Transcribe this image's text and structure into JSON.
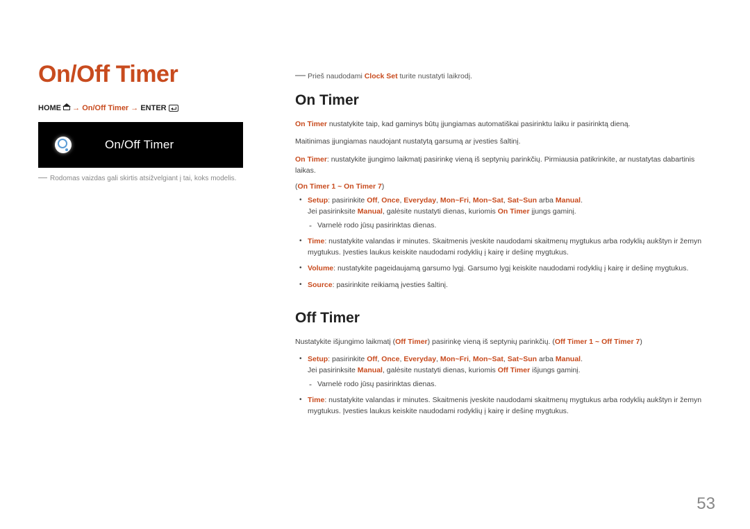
{
  "left": {
    "title": "On/Off Timer",
    "breadcrumb": {
      "home": "HOME",
      "arrow1": " → ",
      "mid": "On/Off Timer",
      "arrow2": " → ",
      "enter": "ENTER"
    },
    "screenshot_label": "On/Off Timer",
    "model_note": "Rodomas vaizdas gali skirtis atsižvelgiant į tai, koks modelis."
  },
  "right": {
    "top_note_prefix": "Prieš naudodami ",
    "top_note_strong": "Clock Set",
    "top_note_suffix": " turite nustatyti laikrodį.",
    "on_timer": {
      "heading": "On Timer",
      "p1_strong": "On Timer",
      "p1_rest": " nustatykite taip, kad gaminys būtų įjungiamas automatiškai pasirinktu laiku ir pasirinktą dieną.",
      "p2": "Maitinimas įjungiamas naudojant nustatytą garsumą ar įvesties šaltinį.",
      "p3_strong": "On Timer",
      "p3_rest": ": nustatykite įjungimo laikmatį pasirinkę vieną iš septynių parinkčių. Pirmiausia patikrinkite, ar nustatytas dabartinis laikas.",
      "range_open": "(",
      "range_text": "On Timer 1 ~ On Timer 7",
      "range_close": ")",
      "bullets": {
        "setup_label": "Setup",
        "setup_text_a": ": pasirinkite ",
        "setup_opt1": "Off",
        "setup_sep": ", ",
        "setup_opt2": "Once",
        "setup_opt3": "Everyday",
        "setup_opt4": "Mon~Fri",
        "setup_opt5": "Mon~Sat",
        "setup_opt6": "Sat~Sun",
        "setup_arba": " arba ",
        "setup_opt7": "Manual",
        "setup_period": ".",
        "setup_line2a": "Jei pasirinksite ",
        "setup_line2b": "Manual",
        "setup_line2c": ", galėsite nustatyti dienas, kuriomis ",
        "setup_line2d": "On Timer",
        "setup_line2e": " įjungs gaminį.",
        "setup_sub": "Varnelė rodo jūsų pasirinktas dienas.",
        "time_label": "Time",
        "time_text": ": nustatykite valandas ir minutes. Skaitmenis įveskite naudodami skaitmenų mygtukus arba rodyklių aukštyn ir žemyn mygtukus. Įvesties laukus keiskite naudodami rodyklių į kairę ir dešinę mygtukus.",
        "volume_label": "Volume",
        "volume_text": ": nustatykite pageidaujamą garsumo lygį. Garsumo lygį keiskite naudodami rodyklių į kairę ir dešinę mygtukus.",
        "source_label": "Source",
        "source_text": ": pasirinkite reikiamą įvesties šaltinį."
      }
    },
    "off_timer": {
      "heading": "Off Timer",
      "p1_a": "Nustatykite išjungimo laikmatį (",
      "p1_b": "Off Timer",
      "p1_c": ") pasirinkę vieną iš septynių parinkčių. (",
      "p1_d": "Off Timer 1 ~ Off Timer 7",
      "p1_e": ")",
      "bullets": {
        "setup_label": "Setup",
        "setup_text_a": ": pasirinkite ",
        "setup_opt1": "Off",
        "setup_sep": ", ",
        "setup_opt2": "Once",
        "setup_opt3": "Everyday",
        "setup_opt4": "Mon~Fri",
        "setup_opt5": "Mon~Sat",
        "setup_opt6": "Sat~Sun",
        "setup_arba": " arba ",
        "setup_opt7": "Manual",
        "setup_period": ".",
        "setup_line2a": "Jei pasirinksite ",
        "setup_line2b": "Manual",
        "setup_line2c": ", galėsite nustatyti dienas, kuriomis ",
        "setup_line2d": "Off Timer",
        "setup_line2e": " išjungs gaminį.",
        "setup_sub": "Varnelė rodo jūsų pasirinktas dienas.",
        "time_label": "Time",
        "time_text": ": nustatykite valandas ir minutes. Skaitmenis įveskite naudodami skaitmenų mygtukus arba rodyklių aukštyn ir žemyn mygtukus. Įvesties laukus keiskite naudodami rodyklių į kairę ir dešinę mygtukus."
      }
    }
  },
  "page_number": "53"
}
